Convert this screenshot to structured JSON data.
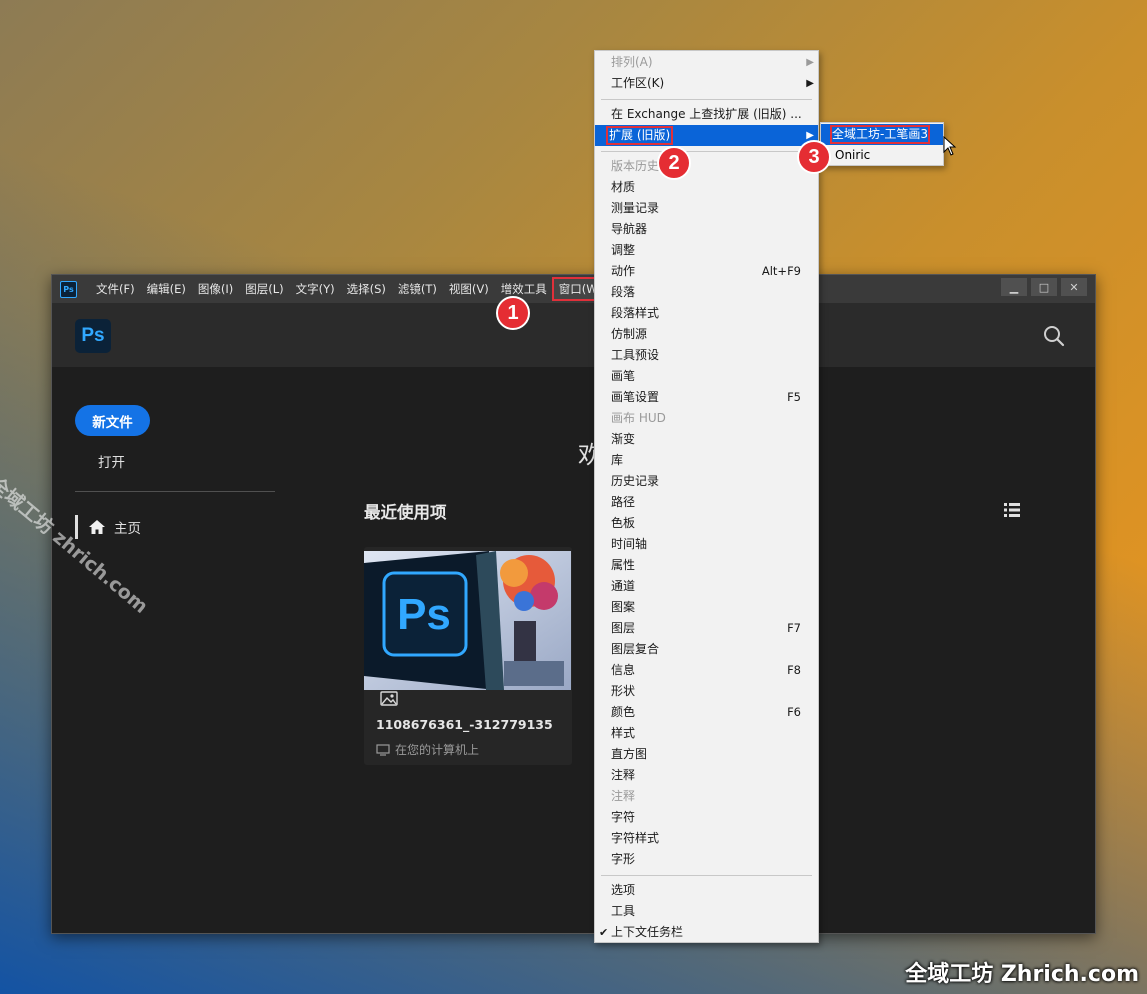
{
  "menubar": {
    "items": [
      "文件(F)",
      "编辑(E)",
      "图像(I)",
      "图层(L)",
      "文字(Y)",
      "选择(S)",
      "滤镜(T)",
      "视图(V)",
      "增效工具",
      "窗口(W)"
    ],
    "active": "窗口(W)",
    "logo": "Ps"
  },
  "window_controls": {
    "minimize": "▁",
    "restore": "□",
    "close": "✕"
  },
  "header": {
    "logo": "Ps"
  },
  "sidebar": {
    "new_file": "新文件",
    "open": "打开",
    "home": "主页"
  },
  "main": {
    "welcome_partial": "欢",
    "recent_title": "最近使用项",
    "file": {
      "name": "1108676361_-312779135",
      "location": "在您的计算机上",
      "thumb_logo": "Ps"
    }
  },
  "dropdown": {
    "items": [
      {
        "label": "排列(A)",
        "submenu": true,
        "disabled": true
      },
      {
        "label": "工作区(K)",
        "submenu": true
      },
      {
        "sep": true
      },
      {
        "label": "在 Exchange 上查找扩展 (旧版) ..."
      },
      {
        "label": "扩展 (旧版)",
        "submenu": true,
        "highlight": true
      },
      {
        "sep": true
      },
      {
        "label": "版本历史",
        "disabled": true
      },
      {
        "label": "材质"
      },
      {
        "label": "测量记录"
      },
      {
        "label": "导航器"
      },
      {
        "label": "调整"
      },
      {
        "label": "动作",
        "shortcut": "Alt+F9"
      },
      {
        "label": "段落"
      },
      {
        "label": "段落样式"
      },
      {
        "label": "仿制源"
      },
      {
        "label": "工具预设"
      },
      {
        "label": "画笔"
      },
      {
        "label": "画笔设置",
        "shortcut": "F5"
      },
      {
        "label": "画布 HUD",
        "disabled": true
      },
      {
        "label": "渐变"
      },
      {
        "label": "库"
      },
      {
        "label": "历史记录"
      },
      {
        "label": "路径"
      },
      {
        "label": "色板"
      },
      {
        "label": "时间轴"
      },
      {
        "label": "属性"
      },
      {
        "label": "通道"
      },
      {
        "label": "图案"
      },
      {
        "label": "图层",
        "shortcut": "F7"
      },
      {
        "label": "图层复合"
      },
      {
        "label": "信息",
        "shortcut": "F8"
      },
      {
        "label": "形状"
      },
      {
        "label": "颜色",
        "shortcut": "F6"
      },
      {
        "label": "样式"
      },
      {
        "label": "直方图"
      },
      {
        "label": "注释"
      },
      {
        "label": "注释",
        "disabled": true
      },
      {
        "label": "字符"
      },
      {
        "label": "字符样式"
      },
      {
        "label": "字形"
      },
      {
        "sep": true
      },
      {
        "label": "选项"
      },
      {
        "label": "工具"
      },
      {
        "label": "上下文任务栏",
        "checked": true
      }
    ]
  },
  "submenu": {
    "items": [
      "全域工坊-工笔画3",
      "Oniric"
    ]
  },
  "badges": [
    "1",
    "2",
    "3"
  ],
  "watermark": {
    "diagonal": "全域工坊 zhrich.com",
    "corner": "全域工坊 Zhrich.com"
  },
  "colors": {
    "accent": "#1473e6",
    "highlight": "#0a64d8",
    "badge": "#e52d33",
    "ps_blue": "#31a8ff"
  }
}
